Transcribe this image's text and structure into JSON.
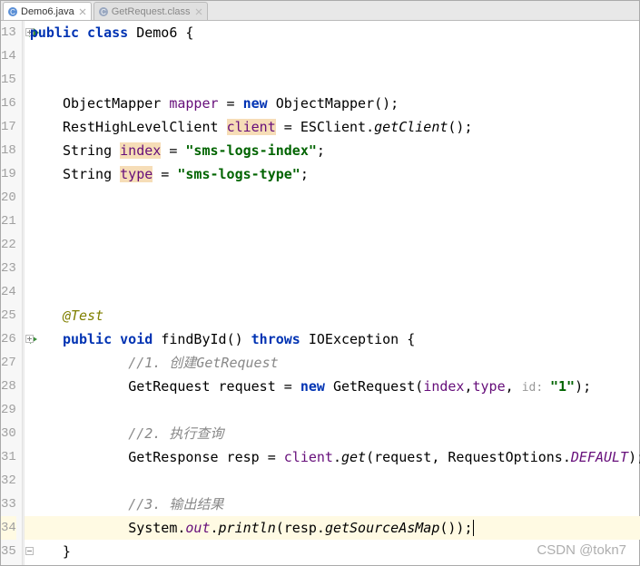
{
  "tabs": [
    {
      "label": "Demo6.java",
      "active": true
    },
    {
      "label": "GetRequest.class",
      "active": false
    }
  ],
  "line_start": 13,
  "line_end": 35,
  "code": {
    "13": {
      "t": [
        "public class Demo6 {"
      ],
      "indent": 0
    },
    "14": {
      "blank": true
    },
    "15": {
      "blank": true
    },
    "16": {
      "t": [
        "ObjectMapper mapper = new ObjectMapper();"
      ],
      "indent": 1
    },
    "17": {
      "t": [
        "RestHighLevelClient client = ESClient.getClient();"
      ],
      "indent": 1
    },
    "18": {
      "t": [
        "String index = \"sms-logs-index\";"
      ],
      "indent": 1
    },
    "19": {
      "t": [
        "String type = \"sms-logs-type\";"
      ],
      "indent": 1
    },
    "20": {
      "blank": true
    },
    "21": {
      "blank": true
    },
    "22": {
      "blank": true
    },
    "23": {
      "blank": true
    },
    "24": {
      "blank": true
    },
    "25": {
      "t": [
        "@Test"
      ],
      "indent": 1
    },
    "26": {
      "t": [
        "public void findById() throws IOException {"
      ],
      "indent": 1
    },
    "27": {
      "t": [
        "//1. 创建GetRequest"
      ],
      "indent": 2
    },
    "28": {
      "t": [
        "GetRequest request = new GetRequest(index,type, id: \"1\");"
      ],
      "indent": 2
    },
    "29": {
      "blank": true
    },
    "30": {
      "t": [
        "//2. 执行查询"
      ],
      "indent": 2
    },
    "31": {
      "t": [
        "GetResponse resp = client.get(request, RequestOptions.DEFAULT);"
      ],
      "indent": 2
    },
    "32": {
      "blank": true
    },
    "33": {
      "t": [
        "//3. 输出结果"
      ],
      "indent": 2
    },
    "34": {
      "t": [
        "System.out.println(resp.getSourceAsMap());"
      ],
      "indent": 2,
      "hl": true,
      "caret": true
    },
    "35": {
      "t": [
        "}"
      ],
      "indent": 1
    }
  },
  "run_markers": {
    "13": "double",
    "26": "single"
  },
  "fold_markers": {
    "13": "start",
    "26": "start",
    "35": "end"
  },
  "watermark": "CSDN @tokn7",
  "strings": {
    "sms_index": "\"sms-logs-index\"",
    "sms_type": "\"sms-logs-type\"",
    "id_one": "\"1\"",
    "id_hint": "id: "
  },
  "chart_data": null
}
